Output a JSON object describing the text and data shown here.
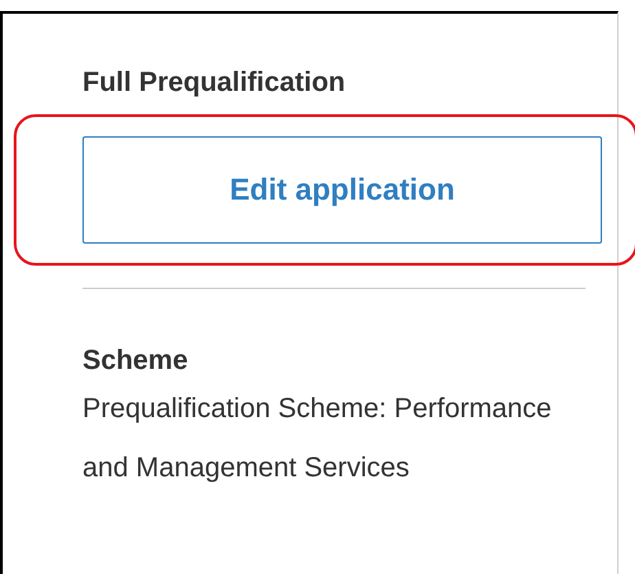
{
  "section": {
    "title": "Full Prequalification",
    "button": {
      "label": "Edit application",
      "highlighted": true
    }
  },
  "scheme": {
    "heading": "Scheme",
    "text": "Prequalification Scheme: Performance and Management Services"
  }
}
